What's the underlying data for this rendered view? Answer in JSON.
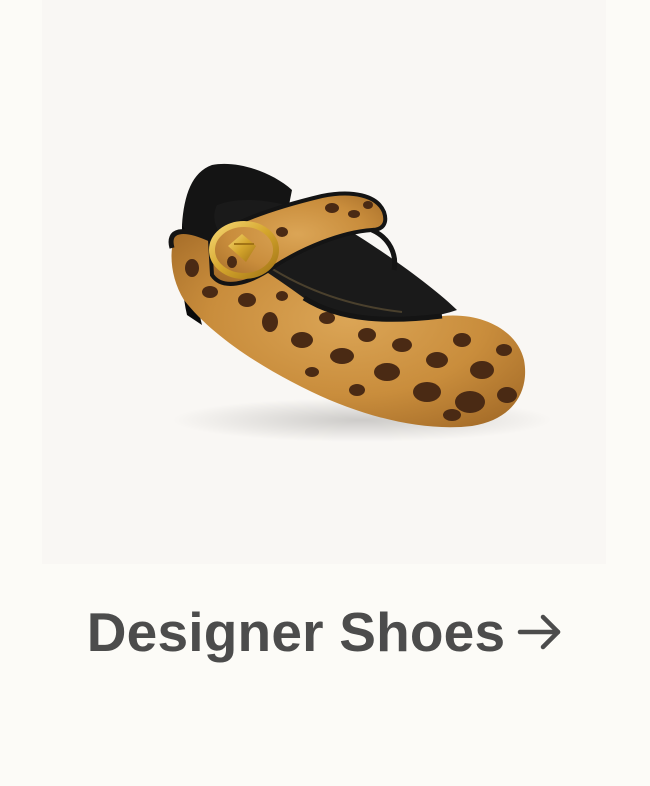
{
  "product_image": {
    "subject": "leopard-print-mary-jane-flat",
    "colors": {
      "background": "#f9f7f4",
      "fur_base": "#c98d3c",
      "spots": "#4a2a14",
      "trim": "#141414",
      "buckle": "#d4a52c"
    }
  },
  "cta": {
    "label": "Designer Shoes",
    "icon": "arrow-right-icon",
    "color": "#4c4c4c"
  },
  "page": {
    "background": "#fcfbf7"
  }
}
